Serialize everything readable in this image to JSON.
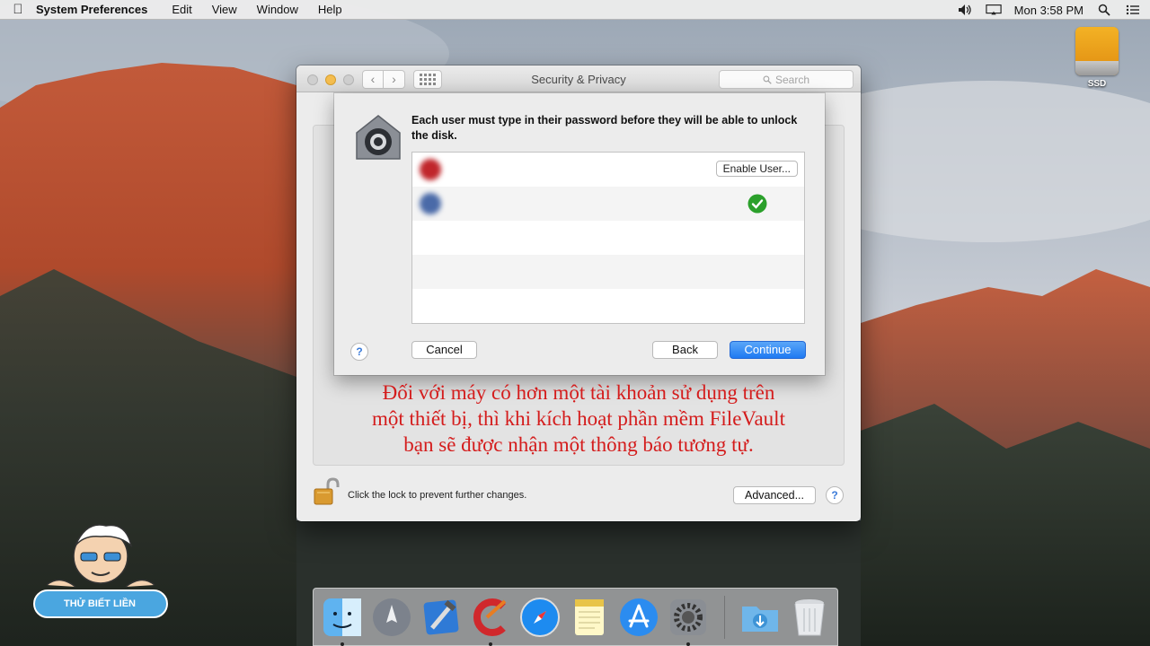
{
  "menubar": {
    "app_name": "System Preferences",
    "items": [
      "Edit",
      "View",
      "Window",
      "Help"
    ],
    "clock": "Mon 3:58 PM"
  },
  "desktop": {
    "ssd_label": "SSD"
  },
  "window": {
    "title": "Security & Privacy",
    "search_placeholder": "Search",
    "lock_message": "Click the lock to prevent further changes.",
    "advanced_label": "Advanced..."
  },
  "sheet": {
    "message": "Each user must type in their password before they will be able to unlock the disk.",
    "users": [
      {
        "name": "",
        "action": "Enable User...",
        "enabled": false,
        "avatar_color": "#c0262b"
      },
      {
        "name": "",
        "action": "",
        "enabled": true,
        "avatar_color": "#4a6aa8"
      }
    ],
    "cancel_label": "Cancel",
    "back_label": "Back",
    "continue_label": "Continue",
    "help_label": "?"
  },
  "caption": {
    "lines": [
      "Đối với máy có hơn một tài khoản sử dụng trên",
      "một thiết bị, thì khi kích hoạt phần mềm FileVault",
      "bạn sẽ được nhận một thông báo tương tự."
    ]
  },
  "dock": {
    "apps": [
      "Finder",
      "Launchpad",
      "Xcode",
      "CCleaner",
      "Safari",
      "Notes",
      "App Store",
      "System Preferences",
      "Downloads",
      "Trash"
    ]
  },
  "watermark": {
    "label": "THỬ BIẾT LIỀN"
  },
  "colors": {
    "accent": "#1f7af2",
    "caption": "#d41c1c",
    "check": "#2ba02b"
  }
}
